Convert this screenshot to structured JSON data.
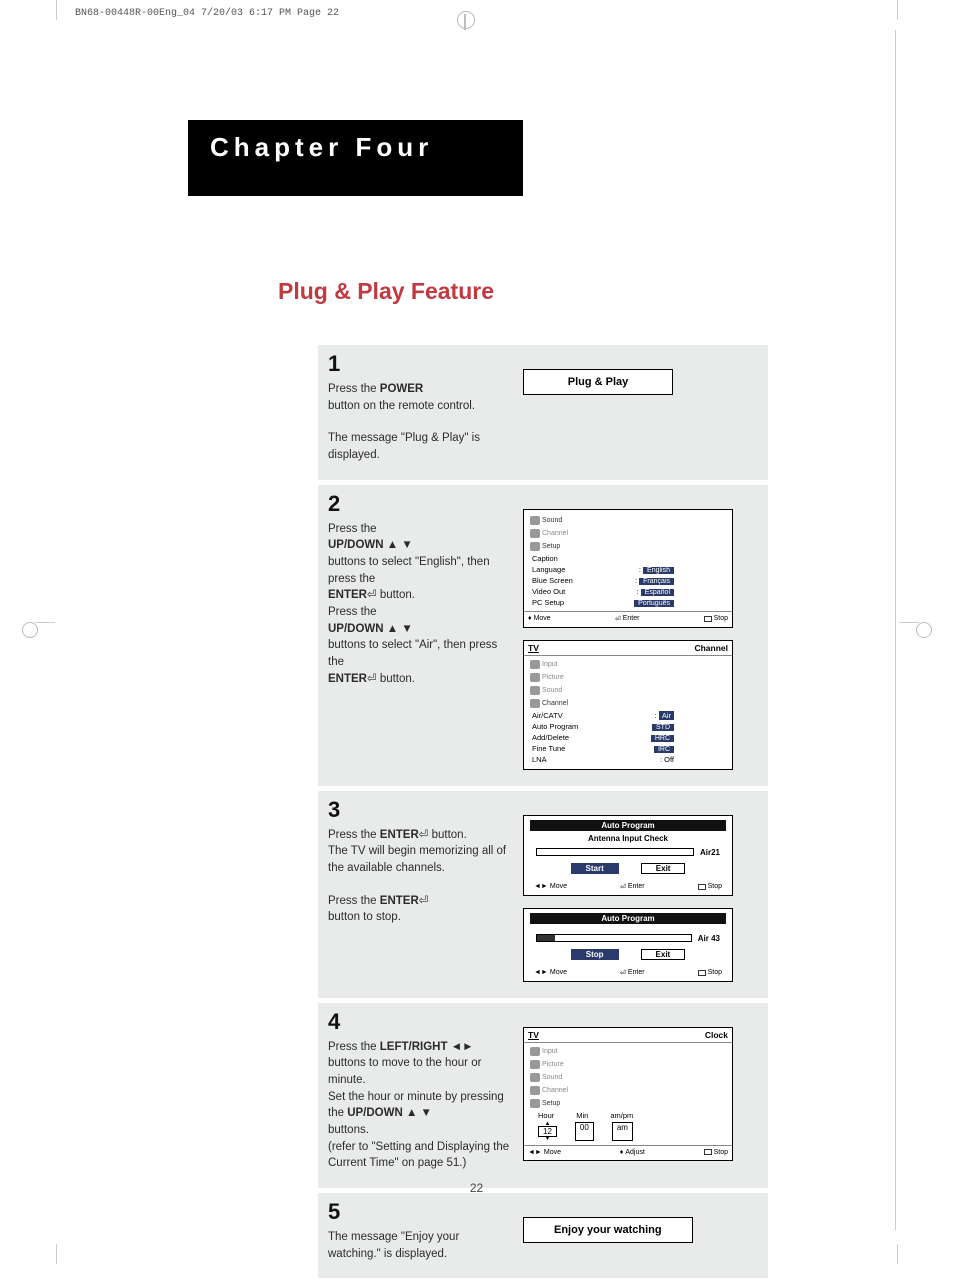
{
  "print_header": "BN68-00448R-00Eng_04  7/20/03 6:17 PM  Page 22",
  "chapter": "Chapter Four",
  "feature": "Plug & Play Feature",
  "page_number": "22",
  "step1": {
    "num": "1",
    "line1a": "Press the ",
    "line1b": "POWER",
    "line2": "button on the remote control.",
    "line3": "The message \"Plug & Play\" is displayed.",
    "box": "Plug & Play"
  },
  "step2": {
    "num": "2",
    "p1": "Press the",
    "p2": "UP/DOWN",
    "p3": "buttons to select \"English\", then press the",
    "p4": "ENTER",
    "p4b": " button.",
    "p5": "Press the",
    "p6": "UP/DOWN",
    "p7": "buttons to select \"Air\", then press the",
    "p8": "ENTER",
    "p8b": " button.",
    "osd1": {
      "sidebar": [
        "Sound",
        "Channel",
        "Setup"
      ],
      "rows": [
        {
          "label": "Caption",
          "val": ""
        },
        {
          "label": "Language",
          "val": "English",
          "hl": true
        },
        {
          "label": "Blue Screen",
          "val": "Français",
          "hl": true
        },
        {
          "label": "Video Out",
          "val": "Español",
          "hl": true
        },
        {
          "label": "PC Setup",
          "val": "Português",
          "hl": true
        }
      ],
      "footer": [
        "Move",
        "Enter",
        "Stop"
      ]
    },
    "osd2": {
      "header_left": "TV",
      "header_right": "Channel",
      "sidebar": [
        "Input",
        "Picture",
        "Sound",
        "Channel"
      ],
      "rows": [
        {
          "label": "Air/CATV",
          "val": "Air",
          "sel": true
        },
        {
          "label": "Auto Program",
          "val": "STD",
          "hl": true
        },
        {
          "label": "Add/Delete",
          "val": "HRC",
          "hl": true
        },
        {
          "label": "Fine Tune",
          "val": "IRC",
          "hl": true
        },
        {
          "label": "LNA",
          "val": "Off"
        }
      ]
    }
  },
  "step3": {
    "num": "3",
    "p1a": "Press the ",
    "p1b": "ENTER",
    "p1c": " button.",
    "p2": "The TV will begin memorizing all of the available channels.",
    "p3a": "Press the ",
    "p3b": "ENTER",
    "p4": "button to stop.",
    "panel1": {
      "title": "Auto Program",
      "sub": "Antenna Input Check",
      "air": "Air21",
      "btn1": "Start",
      "btn2": "Exit",
      "footer": [
        "Move",
        "Enter",
        "Stop"
      ]
    },
    "panel2": {
      "title": "Auto Program",
      "air": "Air 43",
      "btn1": "Stop",
      "btn2": "Exit",
      "footer": [
        "Move",
        "Enter",
        "Stop"
      ]
    }
  },
  "step4": {
    "num": "4",
    "p1a": "Press the ",
    "p1b": "LEFT/RIGHT",
    "p2": "buttons to move to the hour or minute.",
    "p3a": "Set the hour or minute by pressing the ",
    "p3b": "UP/DOWN",
    "p4": "buttons.",
    "p5": "(refer to \"Setting and Displaying the Current Time\" on page 51.)",
    "clock": {
      "header_left": "TV",
      "header_right": "Clock",
      "sidebar": [
        "Input",
        "Picture",
        "Sound",
        "Channel",
        "Setup"
      ],
      "labels": [
        "Hour",
        "Min",
        "am/pm"
      ],
      "vals": [
        "12",
        "00",
        "am"
      ],
      "footer": [
        "Move",
        "Adjust",
        "Stop"
      ]
    }
  },
  "step5": {
    "num": "5",
    "text": "The message \"Enjoy your watching.\" is displayed.",
    "box": "Enjoy your watching"
  }
}
